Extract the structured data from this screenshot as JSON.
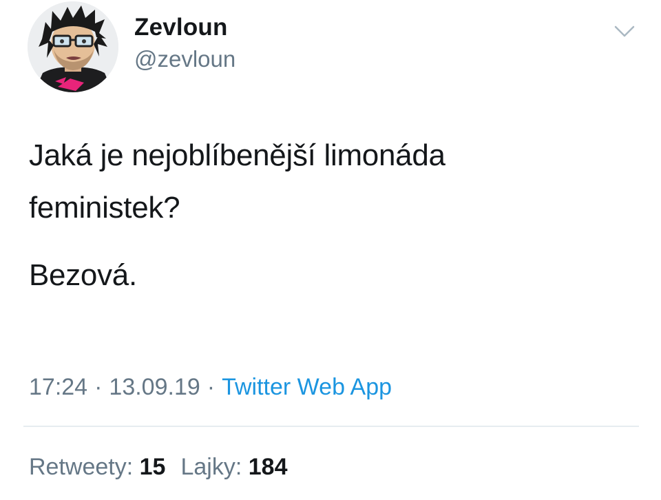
{
  "author": {
    "display_name": "Zevloun",
    "handle": "@zevloun"
  },
  "tweet": {
    "line1": "Jaká je nejoblíbenější limonáda",
    "line2": "feministek?",
    "line3": "Bezová."
  },
  "meta": {
    "time": "17:24",
    "separator": "·",
    "date": "13.09.19",
    "source": "Twitter Web App"
  },
  "stats": {
    "retweets_label": "Retweety:",
    "retweets_count": "15",
    "likes_label": "Lajky:",
    "likes_count": "184"
  },
  "icons": {
    "menu": "chevron-down-icon",
    "avatar": "cartoon-avatar"
  },
  "colors": {
    "text": "#14171a",
    "secondary": "#657786",
    "link": "#1b95e0",
    "divider": "#e6ecf0"
  }
}
